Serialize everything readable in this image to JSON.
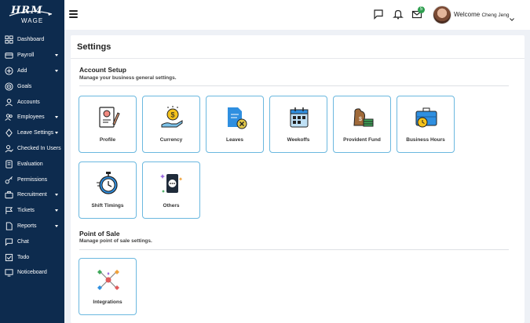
{
  "brand": {
    "logo_top": "HRM",
    "logo_bottom": "WAGE"
  },
  "sidebar": {
    "items": [
      {
        "label": "Dashboard",
        "icon": "dashboard-icon",
        "has_caret": false
      },
      {
        "label": "Payroll",
        "icon": "payroll-icon",
        "has_caret": true
      },
      {
        "label": "Add",
        "icon": "add-icon",
        "has_caret": true
      },
      {
        "label": "Goals",
        "icon": "goals-icon",
        "has_caret": false
      },
      {
        "label": "Accounts",
        "icon": "accounts-icon",
        "has_caret": false
      },
      {
        "label": "Employees",
        "icon": "employees-icon",
        "has_caret": true
      },
      {
        "label": "Leave Settings",
        "icon": "leave-settings-icon",
        "has_caret": true
      },
      {
        "label": "Checked In Users",
        "icon": "checked-in-users-icon",
        "has_caret": false
      },
      {
        "label": "Evaluation",
        "icon": "evaluation-icon",
        "has_caret": false
      },
      {
        "label": "Permissions",
        "icon": "permissions-icon",
        "has_caret": false
      },
      {
        "label": "Recruitment",
        "icon": "recruitment-icon",
        "has_caret": true
      },
      {
        "label": "Tickets",
        "icon": "tickets-icon",
        "has_caret": true
      },
      {
        "label": "Reports",
        "icon": "reports-icon",
        "has_caret": true
      },
      {
        "label": "Chat",
        "icon": "chat-icon",
        "has_caret": false
      },
      {
        "label": "Todo",
        "icon": "todo-icon",
        "has_caret": false
      },
      {
        "label": "Noticeboard",
        "icon": "noticeboard-icon",
        "has_caret": false
      }
    ]
  },
  "header": {
    "notification_count": "5",
    "welcome_text": "Welcome",
    "user_name": "Cheng Jeng"
  },
  "page": {
    "title": "Settings",
    "sections": [
      {
        "title": "Account Setup",
        "subtitle": "Manage your business general settings.",
        "cards": [
          {
            "label": "Profile",
            "icon": "profile-icon"
          },
          {
            "label": "Currency",
            "icon": "currency-icon"
          },
          {
            "label": "Leaves",
            "icon": "leaves-icon"
          },
          {
            "label": "Weekoffs",
            "icon": "weekoffs-icon"
          },
          {
            "label": "Provident Fund",
            "icon": "provident-fund-icon"
          },
          {
            "label": "Business Hours",
            "icon": "business-hours-icon"
          },
          {
            "label": "Shift Timings",
            "icon": "shift-timings-icon"
          },
          {
            "label": "Others",
            "icon": "others-icon"
          }
        ]
      },
      {
        "title": "Point of Sale",
        "subtitle": "Manage point of sale settings.",
        "cards": [
          {
            "label": "Integrations",
            "icon": "integrations-icon"
          }
        ]
      }
    ]
  },
  "colors": {
    "sidebar_bg": "#0d2b4e",
    "card_border": "#6bb8df",
    "badge": "#2e9e4f",
    "page_bg": "#eef1f6"
  }
}
